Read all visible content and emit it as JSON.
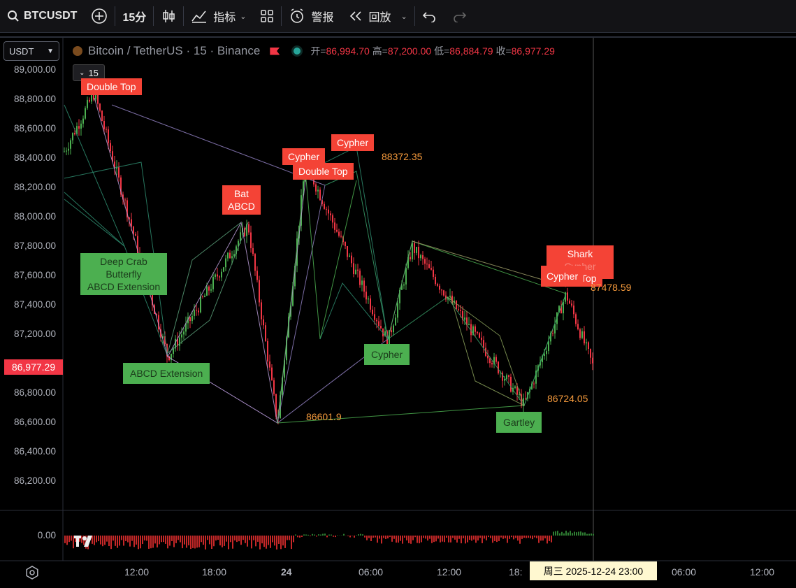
{
  "toolbar": {
    "symbol": "BTCUSDT",
    "interval": "15分",
    "indicators": "指标",
    "alert": "警报",
    "replay": "回放"
  },
  "legend": {
    "title": "Bitcoin / TetherUS · 15 · Binance",
    "open_label": "开=",
    "open": "86,994.70",
    "high_label": "高=",
    "high": "87,200.00",
    "low_label": "低=",
    "low": "86,884.79",
    "close_label": "收=",
    "close": "86,977.29"
  },
  "currency_select": "USDT",
  "interval_badge": "15",
  "price_axis": [
    "89,000.00",
    "88,800.00",
    "88,600.00",
    "88,400.00",
    "88,200.00",
    "88,000.00",
    "87,800.00",
    "87,600.00",
    "87,400.00",
    "87,200.00",
    "87,000.00",
    "86,800.00",
    "86,600.00",
    "86,400.00",
    "86,200.00"
  ],
  "current_price": "86,977.29",
  "osc_zero": "0.00",
  "time_axis": [
    "12:00",
    "18:00",
    "24",
    "06:00",
    "12:00",
    "18:",
    "06:00",
    "12:00"
  ],
  "crosshair_date": "周三  2025-12-24    23:00",
  "patterns": {
    "double_top_1": "Double Top",
    "cypher_1": "Cypher",
    "cypher_2": "Cypher",
    "double_top_2": "Double Top",
    "bat": "Bat",
    "abcd": "ABCD",
    "deep_crab": "Deep Crab",
    "butterfly": "Butterfly",
    "abcd_ext": "ABCD Extension",
    "abcd_ext2": "ABCD Extension",
    "cypher_green": "Cypher",
    "gartley": "Gartley",
    "shark": "Shark",
    "cypher_3": "Cypher",
    "top": "Top",
    "cypher_hidden": "Cypher"
  },
  "values": {
    "v1": "88372.35",
    "v2": "86601.9",
    "v3": "86724.05",
    "v4": "87478.59"
  },
  "colors": {
    "up": "#26a69a",
    "down": "#f23645",
    "wick_up": "#4caf50",
    "accent": "#f23645"
  },
  "chart_data": {
    "type": "line",
    "ylim": [
      86100,
      89100
    ],
    "pivots": [
      {
        "label": "H",
        "y": 88850
      },
      {
        "label": "L",
        "y": 87050
      },
      {
        "label": "H",
        "y": 87950
      },
      {
        "label": "L",
        "y": 86601.9
      },
      {
        "label": "H",
        "y": 88372.35
      },
      {
        "label": "L",
        "y": 87150
      },
      {
        "label": "H",
        "y": 87800
      },
      {
        "label": "L",
        "y": 86724.05
      },
      {
        "label": "H",
        "y": 87478.59
      },
      {
        "label": "close",
        "y": 86977.29
      }
    ]
  }
}
